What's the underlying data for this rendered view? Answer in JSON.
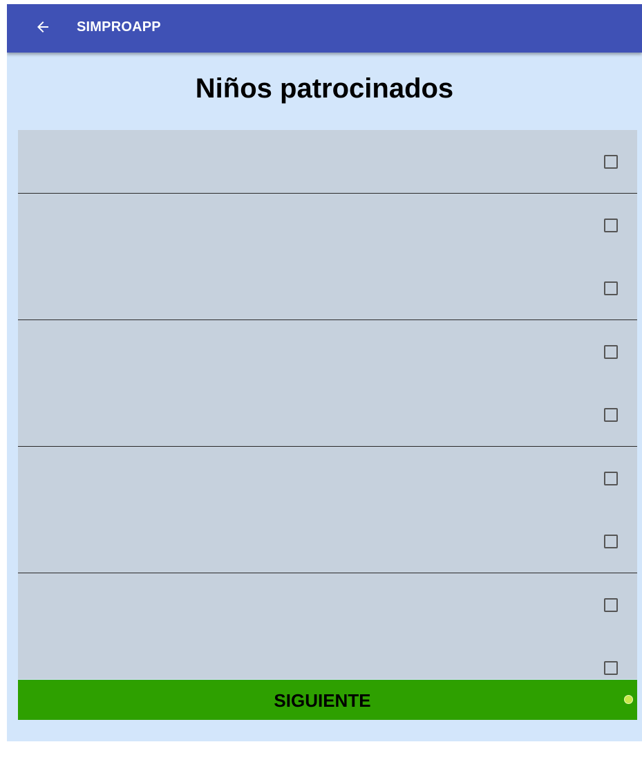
{
  "app_bar": {
    "title": "SIMPROAPP",
    "back_icon": "arrow-left-icon"
  },
  "page": {
    "title": "Niños patrocinados"
  },
  "list": {
    "items": [
      {
        "label": "",
        "checked": false
      },
      {
        "label": "",
        "checked": false
      },
      {
        "label": "",
        "checked": false
      },
      {
        "label": "",
        "checked": false
      },
      {
        "label": "",
        "checked": false
      },
      {
        "label": "",
        "checked": false
      },
      {
        "label": "",
        "checked": false
      },
      {
        "label": "",
        "checked": false
      },
      {
        "label": "",
        "checked": false
      }
    ]
  },
  "footer": {
    "next_label": "SIGUIENTE"
  },
  "colors": {
    "app_bar": "#3f51b5",
    "background": "#d3e6fb",
    "row": "#c6d1dd",
    "button": "#2ea000",
    "dot": "#c8e84a"
  }
}
